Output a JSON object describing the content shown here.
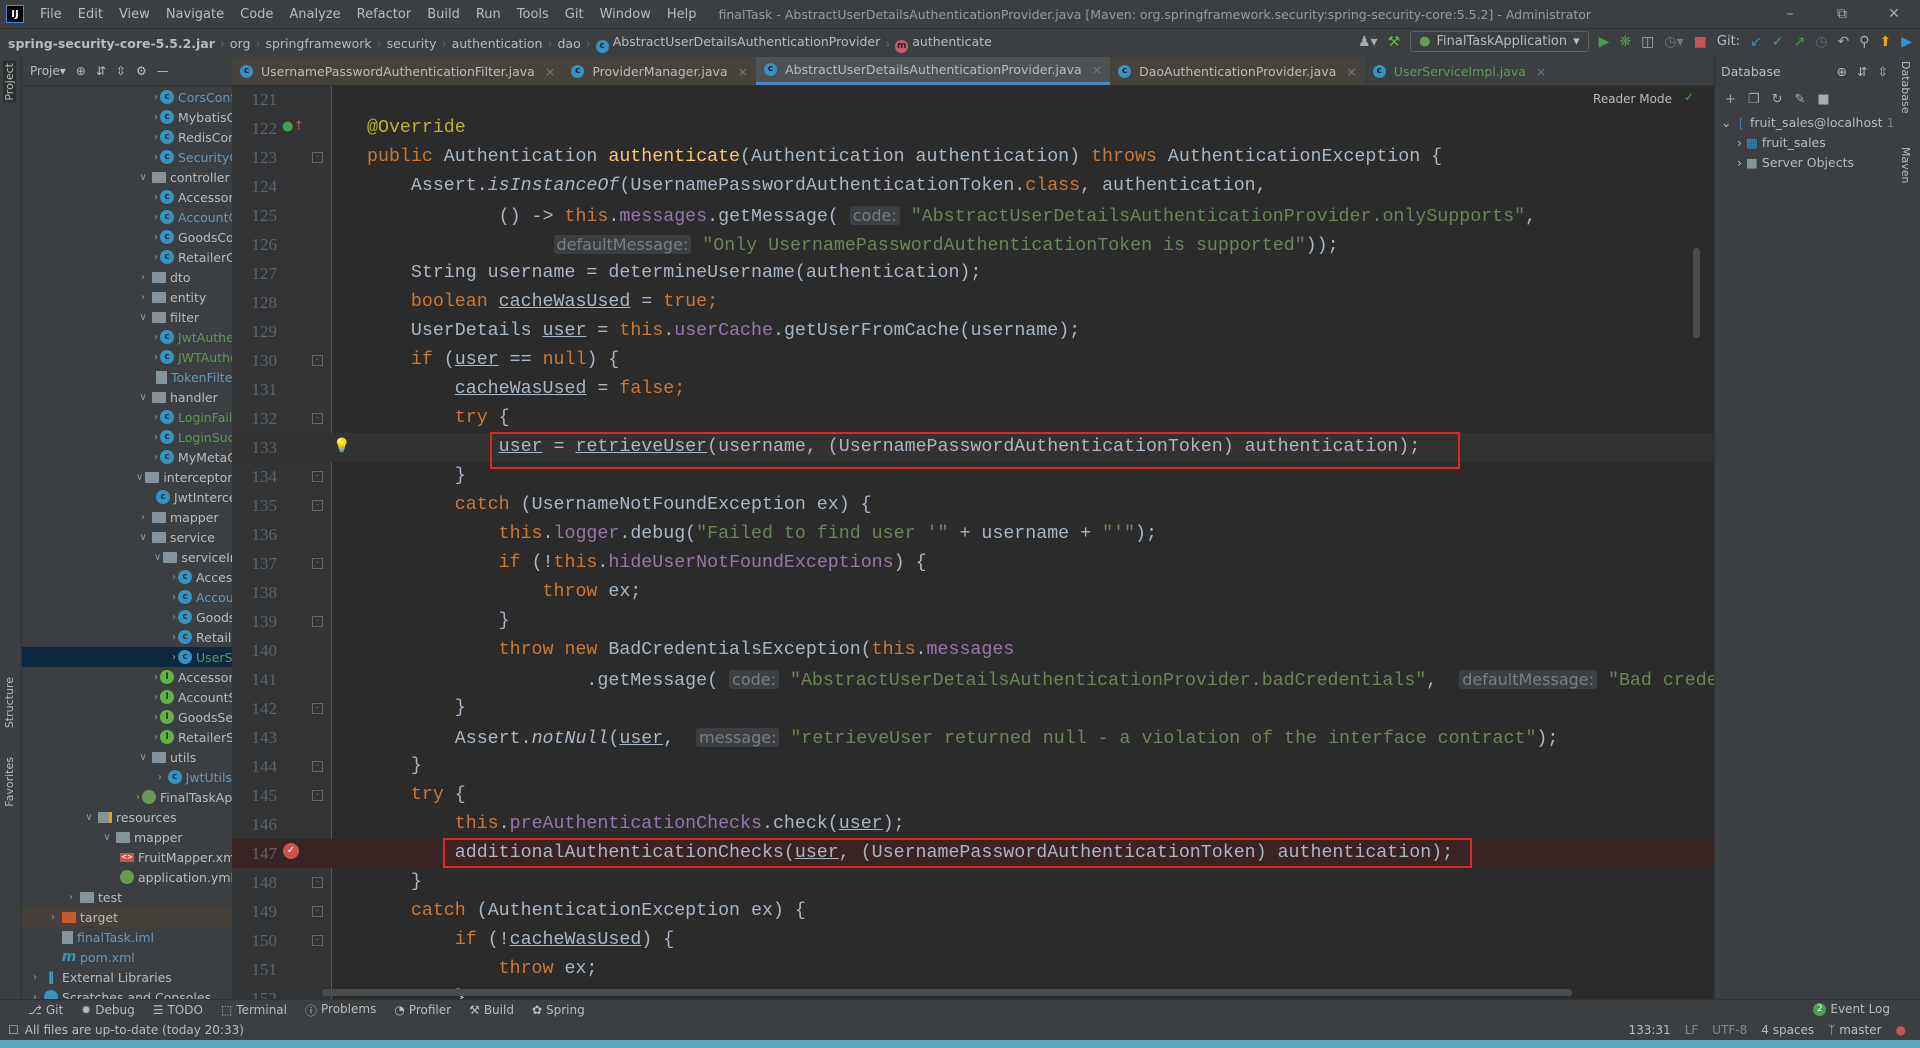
{
  "titlebar": {
    "menu": [
      "File",
      "Edit",
      "View",
      "Navigate",
      "Code",
      "Analyze",
      "Refactor",
      "Build",
      "Run",
      "Tools",
      "Git",
      "Window",
      "Help"
    ],
    "title": "finalTask - AbstractUserDetailsAuthenticationProvider.java [Maven: org.springframework.security:spring-security-core:5.5.2] - Administrator",
    "logo": "IJ"
  },
  "breadcrumb": [
    "spring-security-core-5.5.2.jar",
    "org",
    "springframework",
    "security",
    "authentication",
    "dao",
    "AbstractUserDetailsAuthenticationProvider",
    "authenticate"
  ],
  "run": {
    "config": "FinalTaskApplication",
    "git_label": "Git:"
  },
  "left_stripe": {
    "project": "Project",
    "structure": "Structure",
    "favorites": "Favorites"
  },
  "project": {
    "title": "Proje▾",
    "items": [
      {
        "label": "CorsConfig",
        "lvl": 7,
        "icon": "class",
        "color": "blue",
        "arrow": "closed"
      },
      {
        "label": "MybatisConfig",
        "lvl": 7,
        "icon": "class",
        "color": "white",
        "arrow": "closed"
      },
      {
        "label": "RedisConfig",
        "lvl": 7,
        "icon": "class",
        "color": "white",
        "arrow": "closed"
      },
      {
        "label": "SecurityConfig",
        "lvl": 7,
        "icon": "class",
        "color": "blue",
        "arrow": "closed"
      },
      {
        "label": "controller",
        "lvl": 6,
        "icon": "folder",
        "color": "white",
        "arrow": "open"
      },
      {
        "label": "AccessoryController",
        "lvl": 7,
        "icon": "class",
        "color": "white",
        "arrow": "closed"
      },
      {
        "label": "AccountController",
        "lvl": 7,
        "icon": "class",
        "color": "blue",
        "arrow": "closed"
      },
      {
        "label": "GoodsController",
        "lvl": 7,
        "icon": "class",
        "color": "white",
        "arrow": "closed"
      },
      {
        "label": "RetailerController",
        "lvl": 7,
        "icon": "class",
        "color": "white",
        "arrow": "closed"
      },
      {
        "label": "dto",
        "lvl": 6,
        "icon": "folder",
        "color": "white",
        "arrow": "closed"
      },
      {
        "label": "entity",
        "lvl": 6,
        "icon": "folder",
        "color": "white",
        "arrow": "closed"
      },
      {
        "label": "filter",
        "lvl": 6,
        "icon": "folder",
        "color": "white",
        "arrow": "open"
      },
      {
        "label": "JwtAuthenticationFilter",
        "lvl": 7,
        "icon": "class",
        "color": "green",
        "arrow": "closed"
      },
      {
        "label": "JWTAuthorizationFilter",
        "lvl": 7,
        "icon": "class",
        "color": "green",
        "arrow": "closed"
      },
      {
        "label": "TokenFilter",
        "lvl": 7,
        "icon": "file",
        "color": "blue",
        "arrow": "none"
      },
      {
        "label": "handler",
        "lvl": 6,
        "icon": "folder",
        "color": "white",
        "arrow": "open"
      },
      {
        "label": "LoginFailureHandler",
        "lvl": 7,
        "icon": "class",
        "color": "green",
        "arrow": "closed"
      },
      {
        "label": "LoginSuccessHandler",
        "lvl": 7,
        "icon": "class",
        "color": "green",
        "arrow": "closed"
      },
      {
        "label": "MyMetaObjectHandler",
        "lvl": 7,
        "icon": "class",
        "color": "white",
        "arrow": "closed"
      },
      {
        "label": "interceptor",
        "lvl": 6,
        "icon": "folder",
        "color": "white",
        "arrow": "open"
      },
      {
        "label": "JwtInterceptor",
        "lvl": 7,
        "icon": "class",
        "color": "white",
        "arrow": "none"
      },
      {
        "label": "mapper",
        "lvl": 6,
        "icon": "folder",
        "color": "white",
        "arrow": "closed"
      },
      {
        "label": "service",
        "lvl": 6,
        "icon": "folder",
        "color": "white",
        "arrow": "open"
      },
      {
        "label": "serviceImpl",
        "lvl": 7,
        "icon": "folder",
        "color": "white",
        "arrow": "open"
      },
      {
        "label": "AccessoryServiceImpl",
        "lvl": 8,
        "icon": "class",
        "color": "white",
        "arrow": "closed"
      },
      {
        "label": "AccountServiceImpl",
        "lvl": 8,
        "icon": "class",
        "color": "blue",
        "arrow": "closed"
      },
      {
        "label": "GoodsServiceImpl",
        "lvl": 8,
        "icon": "class",
        "color": "white",
        "arrow": "closed"
      },
      {
        "label": "RetailerServiceImpl",
        "lvl": 8,
        "icon": "class",
        "color": "white",
        "arrow": "closed"
      },
      {
        "label": "UserServiceImpl",
        "lvl": 8,
        "icon": "class",
        "color": "green",
        "arrow": "closed",
        "selected": true
      },
      {
        "label": "AccessoryService",
        "lvl": 7,
        "icon": "iface",
        "color": "white",
        "arrow": "closed"
      },
      {
        "label": "AccountService",
        "lvl": 7,
        "icon": "iface",
        "color": "white",
        "arrow": "closed"
      },
      {
        "label": "GoodsService",
        "lvl": 7,
        "icon": "iface",
        "color": "white",
        "arrow": "closed"
      },
      {
        "label": "RetailerService",
        "lvl": 7,
        "icon": "iface",
        "color": "white",
        "arrow": "closed"
      },
      {
        "label": "utils",
        "lvl": 6,
        "icon": "folder",
        "color": "white",
        "arrow": "open"
      },
      {
        "label": "JwtUtils",
        "lvl": 7,
        "icon": "class",
        "color": "blue",
        "arrow": "closed"
      },
      {
        "label": "FinalTaskApplication",
        "lvl": 6,
        "icon": "spring",
        "color": "white",
        "arrow": "closed"
      },
      {
        "label": "resources",
        "lvl": 3,
        "icon": "res",
        "color": "white",
        "arrow": "open"
      },
      {
        "label": "mapper",
        "lvl": 4,
        "icon": "folder",
        "color": "white",
        "arrow": "open"
      },
      {
        "label": "FruitMapper.xml",
        "lvl": 5,
        "icon": "xml",
        "color": "white",
        "arrow": "none"
      },
      {
        "label": "application.yml",
        "lvl": 5,
        "icon": "spring",
        "color": "white",
        "arrow": "none"
      },
      {
        "label": "test",
        "lvl": 2,
        "icon": "folder",
        "color": "white",
        "arrow": "closed"
      },
      {
        "label": "target",
        "lvl": 1,
        "icon": "folder-orange",
        "color": "white",
        "arrow": "closed",
        "highlight": true
      },
      {
        "label": "finalTask.iml",
        "lvl": 1,
        "icon": "file",
        "color": "blue",
        "arrow": "none"
      },
      {
        "label": "pom.xml",
        "lvl": 1,
        "icon": "maven",
        "color": "blue",
        "arrow": "none"
      },
      {
        "label": "External Libraries",
        "lvl": 0,
        "icon": "lib",
        "color": "white",
        "arrow": "closed"
      },
      {
        "label": "Scratches and Consoles",
        "lvl": 0,
        "icon": "scratch",
        "color": "white",
        "arrow": "closed"
      }
    ]
  },
  "tabs": [
    {
      "label": "UsernamePasswordAuthenticationFilter.java",
      "state": "dim"
    },
    {
      "label": "ProviderManager.java",
      "state": "dim"
    },
    {
      "label": "AbstractUserDetailsAuthenticationProvider.java",
      "state": "active"
    },
    {
      "label": "DaoAuthenticationProvider.java",
      "state": "dim"
    },
    {
      "label": "UserServiceImpl.java",
      "state": "normal",
      "color": "#629755"
    }
  ],
  "editor": {
    "reader_mode": "Reader Mode",
    "lines": [
      {
        "n": 121,
        "t": []
      },
      {
        "n": 122,
        "t": [
          [
            "a",
            "@Override"
          ]
        ]
      },
      {
        "n": 123,
        "fold": true,
        "t": [
          [
            "k",
            "public "
          ],
          [
            "d",
            "Authentication "
          ],
          [
            "m",
            "authenticate"
          ],
          [
            "d",
            "(Authentication authentication) "
          ],
          [
            "k",
            "throws "
          ],
          [
            "d",
            "AuthenticationException {"
          ]
        ]
      },
      {
        "n": 124,
        "t": [
          [
            "d",
            "    Assert."
          ],
          [
            "i",
            "isInstanceOf"
          ],
          [
            "d",
            "(UsernamePasswordAuthenticationToken."
          ],
          [
            "k",
            "class"
          ],
          [
            "d",
            ", authentication,"
          ]
        ]
      },
      {
        "n": 125,
        "t": [
          [
            "d",
            "            () -> "
          ],
          [
            "k",
            "this"
          ],
          [
            "d",
            "."
          ],
          [
            "f",
            "messages"
          ],
          [
            "d",
            ".getMessage( "
          ],
          [
            "h",
            "code:"
          ],
          [
            "s",
            " \"AbstractUserDetailsAuthenticationProvider.onlySupports\""
          ],
          [
            "d",
            ","
          ]
        ]
      },
      {
        "n": 126,
        "t": [
          [
            "d",
            "                 "
          ],
          [
            "h",
            "defaultMessage:"
          ],
          [
            "s",
            " \"Only UsernamePasswordAuthenticationToken is supported\""
          ],
          [
            "d",
            "));"
          ]
        ]
      },
      {
        "n": 127,
        "t": [
          [
            "d",
            "    String username = determineUsername(authentication);"
          ]
        ]
      },
      {
        "n": 128,
        "t": [
          [
            "k",
            "    boolean "
          ],
          [
            "u",
            "cacheWasUsed"
          ],
          [
            "d",
            " = "
          ],
          [
            "k",
            "true;"
          ]
        ]
      },
      {
        "n": 129,
        "t": [
          [
            "d",
            "    UserDetails "
          ],
          [
            "u",
            "user"
          ],
          [
            "d",
            " = "
          ],
          [
            "k",
            "this"
          ],
          [
            "d",
            "."
          ],
          [
            "f",
            "userCache"
          ],
          [
            "d",
            ".getUserFromCache(username);"
          ]
        ]
      },
      {
        "n": 130,
        "fold": true,
        "t": [
          [
            "k",
            "    if "
          ],
          [
            "d",
            "("
          ],
          [
            "u",
            "user"
          ],
          [
            "d",
            " == "
          ],
          [
            "k",
            "null"
          ],
          [
            "d",
            ") {"
          ]
        ]
      },
      {
        "n": 131,
        "t": [
          [
            "d",
            "        "
          ],
          [
            "u",
            "cacheWasUsed"
          ],
          [
            "d",
            " = "
          ],
          [
            "k",
            "false;"
          ]
        ]
      },
      {
        "n": 132,
        "fold": true,
        "t": [
          [
            "k",
            "        try "
          ],
          [
            "d",
            "{"
          ]
        ]
      },
      {
        "n": 133,
        "cur": true,
        "t": [
          [
            "d",
            "            "
          ],
          [
            "u",
            "user"
          ],
          [
            "d",
            " = "
          ],
          [
            "u",
            "retrieveUser"
          ],
          [
            "d",
            "(username, (UsernamePasswordAuthenticationToken) authentication);"
          ]
        ]
      },
      {
        "n": 134,
        "fold": true,
        "t": [
          [
            "d",
            "        }"
          ]
        ]
      },
      {
        "n": 135,
        "fold": true,
        "t": [
          [
            "k",
            "        catch "
          ],
          [
            "d",
            "(UsernameNotFoundException ex) {"
          ]
        ]
      },
      {
        "n": 136,
        "t": [
          [
            "k",
            "            this"
          ],
          [
            "d",
            "."
          ],
          [
            "f",
            "logger"
          ],
          [
            "d",
            ".debug("
          ],
          [
            "s",
            "\"Failed to find user '\""
          ],
          [
            "d",
            " + username + "
          ],
          [
            "s",
            "\"'\""
          ],
          [
            "d",
            ");"
          ]
        ]
      },
      {
        "n": 137,
        "fold": true,
        "t": [
          [
            "k",
            "            if "
          ],
          [
            "d",
            "(!"
          ],
          [
            "k",
            "this"
          ],
          [
            "d",
            "."
          ],
          [
            "f",
            "hideUserNotFoundExceptions"
          ],
          [
            "d",
            ") {"
          ]
        ]
      },
      {
        "n": 138,
        "t": [
          [
            "k",
            "                throw "
          ],
          [
            "d",
            "ex;"
          ]
        ]
      },
      {
        "n": 139,
        "fold": true,
        "t": [
          [
            "d",
            "            }"
          ]
        ]
      },
      {
        "n": 140,
        "t": [
          [
            "k",
            "            throw new "
          ],
          [
            "d",
            "BadCredentialsException("
          ],
          [
            "k",
            "this"
          ],
          [
            "d",
            "."
          ],
          [
            "f",
            "messages"
          ]
        ]
      },
      {
        "n": 141,
        "t": [
          [
            "d",
            "                    .getMessage( "
          ],
          [
            "h",
            "code:"
          ],
          [
            "s",
            " \"AbstractUserDetailsAuthenticationProvider.badCredentials\""
          ],
          [
            "d",
            ",  "
          ],
          [
            "h",
            "defaultMessage:"
          ],
          [
            "s",
            " \"Bad credentials\""
          ],
          [
            "d",
            "));"
          ]
        ]
      },
      {
        "n": 142,
        "fold": true,
        "t": [
          [
            "d",
            "        }"
          ]
        ]
      },
      {
        "n": 143,
        "t": [
          [
            "d",
            "        Assert."
          ],
          [
            "i",
            "notNull"
          ],
          [
            "d",
            "("
          ],
          [
            "u",
            "user"
          ],
          [
            "d",
            ",  "
          ],
          [
            "h",
            "message:"
          ],
          [
            "s",
            " \"retrieveUser returned null - a violation of the interface contract\""
          ],
          [
            "d",
            ");"
          ]
        ]
      },
      {
        "n": 144,
        "fold": true,
        "t": [
          [
            "d",
            "    }"
          ]
        ]
      },
      {
        "n": 145,
        "fold": true,
        "t": [
          [
            "k",
            "    try "
          ],
          [
            "d",
            "{"
          ]
        ]
      },
      {
        "n": 146,
        "t": [
          [
            "k",
            "        this"
          ],
          [
            "d",
            "."
          ],
          [
            "f",
            "preAuthenticationChecks"
          ],
          [
            "d",
            ".check("
          ],
          [
            "u",
            "user"
          ],
          [
            "d",
            ");"
          ]
        ]
      },
      {
        "n": 147,
        "bp": true,
        "t": [
          [
            "d",
            "        additionalAuthenticationChecks("
          ],
          [
            "u",
            "user"
          ],
          [
            "d",
            ", (UsernamePasswordAuthenticationToken) authentication);"
          ]
        ]
      },
      {
        "n": 148,
        "fold": true,
        "t": [
          [
            "d",
            "    }"
          ]
        ]
      },
      {
        "n": 149,
        "fold": true,
        "t": [
          [
            "k",
            "    catch "
          ],
          [
            "d",
            "(AuthenticationException ex) {"
          ]
        ]
      },
      {
        "n": 150,
        "fold": true,
        "t": [
          [
            "k",
            "        if "
          ],
          [
            "d",
            "(!"
          ],
          [
            "u",
            "cacheWasUsed"
          ],
          [
            "d",
            ") {"
          ]
        ]
      },
      {
        "n": 151,
        "t": [
          [
            "k",
            "            throw "
          ],
          [
            "d",
            "ex;"
          ]
        ]
      },
      {
        "n": 152,
        "t": [
          [
            "d",
            "        }"
          ]
        ]
      }
    ]
  },
  "database": {
    "title": "Database",
    "items": [
      {
        "label": "fruit_sales@localhost",
        "count": "1"
      },
      {
        "label": "fruit_sales"
      },
      {
        "label": "Server Objects"
      }
    ]
  },
  "right_stripe": {
    "database": "Database",
    "maven": "Maven"
  },
  "bottom_tools": [
    "Git",
    "Debug",
    "TODO",
    "Terminal",
    "Problems",
    "Profiler",
    "Build",
    "Spring"
  ],
  "event_log": {
    "label": "Event Log",
    "count": "2"
  },
  "status": {
    "message": "All files are up-to-date (today 20:33)",
    "position": "133:31",
    "line_sep": "LF",
    "encoding": "UTF-8",
    "indent": "4 spaces",
    "branch": "master"
  }
}
